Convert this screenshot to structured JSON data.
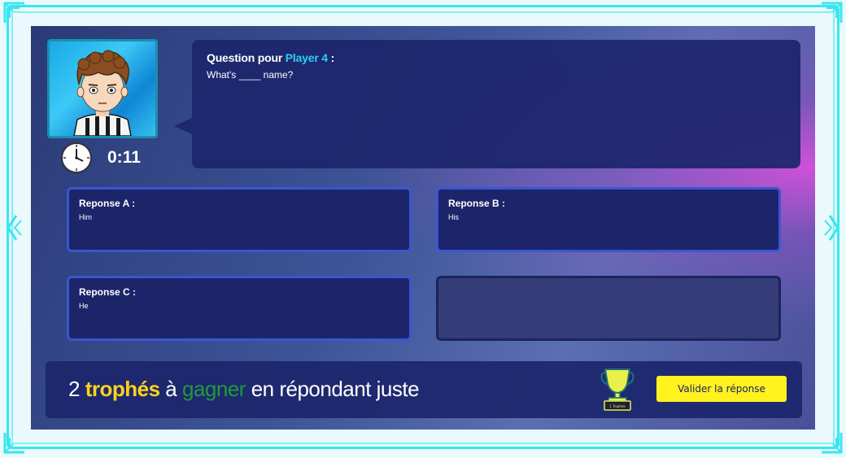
{
  "player": {
    "avatar_icon": "avatar-icon",
    "timer": "0:11"
  },
  "question": {
    "prefix": "Question pour",
    "player_name": "Player 4",
    "suffix": ":",
    "text": "What's ____ name?"
  },
  "answers": [
    {
      "label": "Reponse A :",
      "text": "Him"
    },
    {
      "label": "Reponse B :",
      "text": "His"
    },
    {
      "label": "Reponse C :",
      "text": "He"
    }
  ],
  "reward": {
    "count": "2",
    "trophies_word": "trophés",
    "a": "à",
    "gain_word": "gagner",
    "rest": "en répondant juste",
    "trophy_label": "1 Trophée"
  },
  "actions": {
    "validate_label": "Valider la réponse"
  },
  "colors": {
    "accent_cyan": "#29d0f2",
    "trophy_yellow": "#ffd21a",
    "gain_green": "#1f9a3a",
    "button_yellow": "#fff21f",
    "panel_navy": "#1c2569",
    "frame_cyan": "#39e6f0"
  }
}
